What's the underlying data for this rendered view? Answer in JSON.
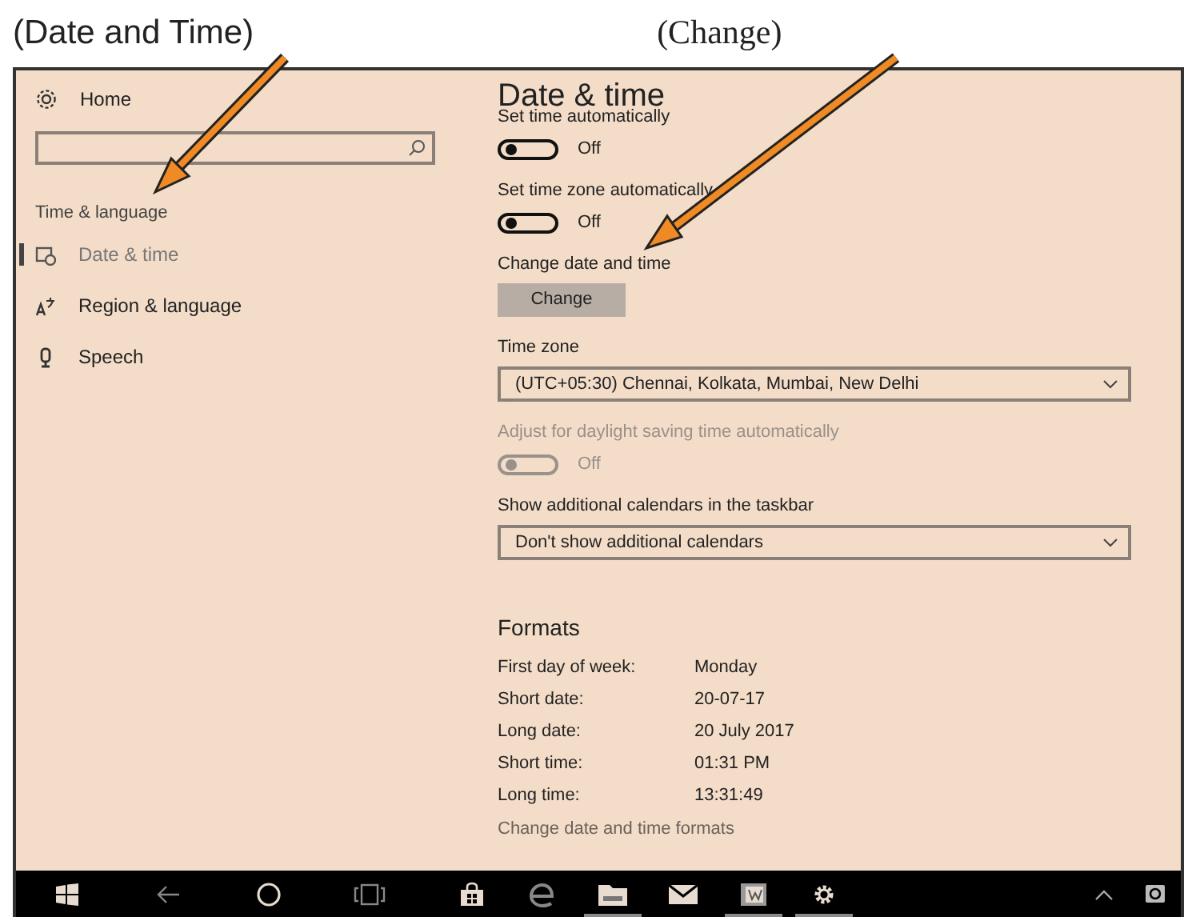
{
  "annotations": [
    {
      "text": "(Date and Time)",
      "kind": "sans"
    },
    {
      "text": "(Change)",
      "kind": "serif"
    }
  ],
  "sidebar": {
    "home": "Home",
    "section": "Time & language",
    "items": [
      {
        "label": "Date & time",
        "kind": "calendar",
        "selected": true
      },
      {
        "label": "Region & language",
        "kind": "language",
        "selected": false
      },
      {
        "label": "Speech",
        "kind": "microphone",
        "selected": false
      }
    ]
  },
  "main": {
    "title": "Date & time",
    "settings": [
      {
        "kind": "toggle",
        "label": "Set time automatically",
        "on": false,
        "disabled": false,
        "state_text": "Off"
      },
      {
        "kind": "toggle",
        "label": "Set time zone automatically",
        "on": false,
        "disabled": false,
        "state_text": "Off"
      },
      {
        "kind": "button",
        "label": "Change date and time",
        "button": "Change"
      },
      {
        "kind": "dropdown",
        "label": "Time zone",
        "value": "(UTC+05:30) Chennai, Kolkata, Mumbai, New Delhi"
      },
      {
        "kind": "toggle",
        "label": "Adjust for daylight saving time automatically",
        "on": false,
        "disabled": true,
        "state_text": "Off"
      },
      {
        "kind": "dropdown",
        "label": "Show additional calendars in the taskbar",
        "value": "Don't show additional calendars"
      }
    ],
    "formats": {
      "title": "Formats",
      "rows": [
        {
          "label": "First day of week:",
          "value": "Monday"
        },
        {
          "label": "Short date:",
          "value": "20-07-17"
        },
        {
          "label": "Long date:",
          "value": "20 July 2017"
        },
        {
          "label": "Short time:",
          "value": "01:31 PM"
        },
        {
          "label": "Long time:",
          "value": "13:31:49"
        }
      ],
      "link": "Change date and time formats"
    }
  },
  "taskbar": {
    "icons": [
      {
        "kind": "windows",
        "running": false
      },
      {
        "kind": "back",
        "running": false
      },
      {
        "kind": "circle",
        "running": false
      },
      {
        "kind": "taskview",
        "running": false
      },
      {
        "kind": "store",
        "running": false
      },
      {
        "kind": "edge",
        "running": false
      },
      {
        "kind": "folder",
        "running": true
      },
      {
        "kind": "mail",
        "running": false
      },
      {
        "kind": "document",
        "running": true
      },
      {
        "kind": "gear",
        "running": true
      }
    ],
    "tray": [
      {
        "kind": "chevron"
      },
      {
        "kind": "message"
      }
    ]
  }
}
